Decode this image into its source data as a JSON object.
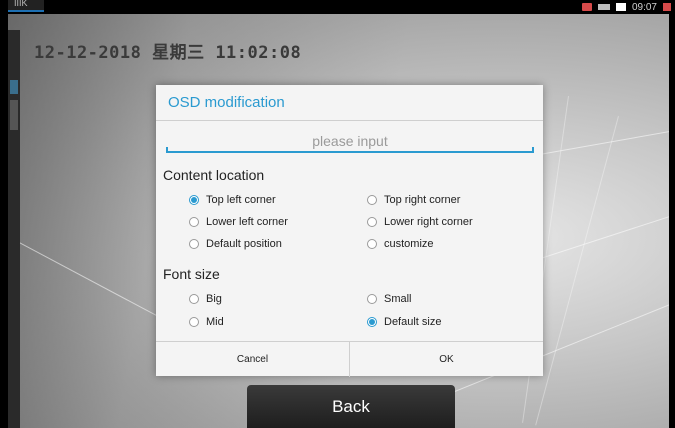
{
  "status_bar": {
    "left_label": "IIIK",
    "time": "09:07",
    "icons": [
      "notification-icon",
      "signal-icon",
      "battery-icon",
      "alert-icon"
    ]
  },
  "osd_overlay": {
    "timestamp": "12-12-2018 星期三 11:02:08"
  },
  "dialog": {
    "title": "OSD modification",
    "input": {
      "placeholder": "please input",
      "value": ""
    },
    "content_location": {
      "heading": "Content location",
      "options": [
        {
          "label": "Top left corner",
          "checked": true
        },
        {
          "label": "Top right corner",
          "checked": false
        },
        {
          "label": "Lower left corner",
          "checked": false
        },
        {
          "label": "Lower right corner",
          "checked": false
        },
        {
          "label": "Default position",
          "checked": false
        },
        {
          "label": "customize",
          "checked": false
        }
      ]
    },
    "font_size": {
      "heading": "Font size",
      "options": [
        {
          "label": "Big",
          "checked": false
        },
        {
          "label": "Small",
          "checked": false
        },
        {
          "label": "Mid",
          "checked": false
        },
        {
          "label": "Default size",
          "checked": true
        }
      ]
    },
    "cancel_label": "Cancel",
    "ok_label": "OK"
  },
  "back_label": "Back",
  "colors": {
    "accent": "#2a9ad0",
    "dialog_bg": "#f4f4f4",
    "back_button": "#2a2a2a"
  }
}
